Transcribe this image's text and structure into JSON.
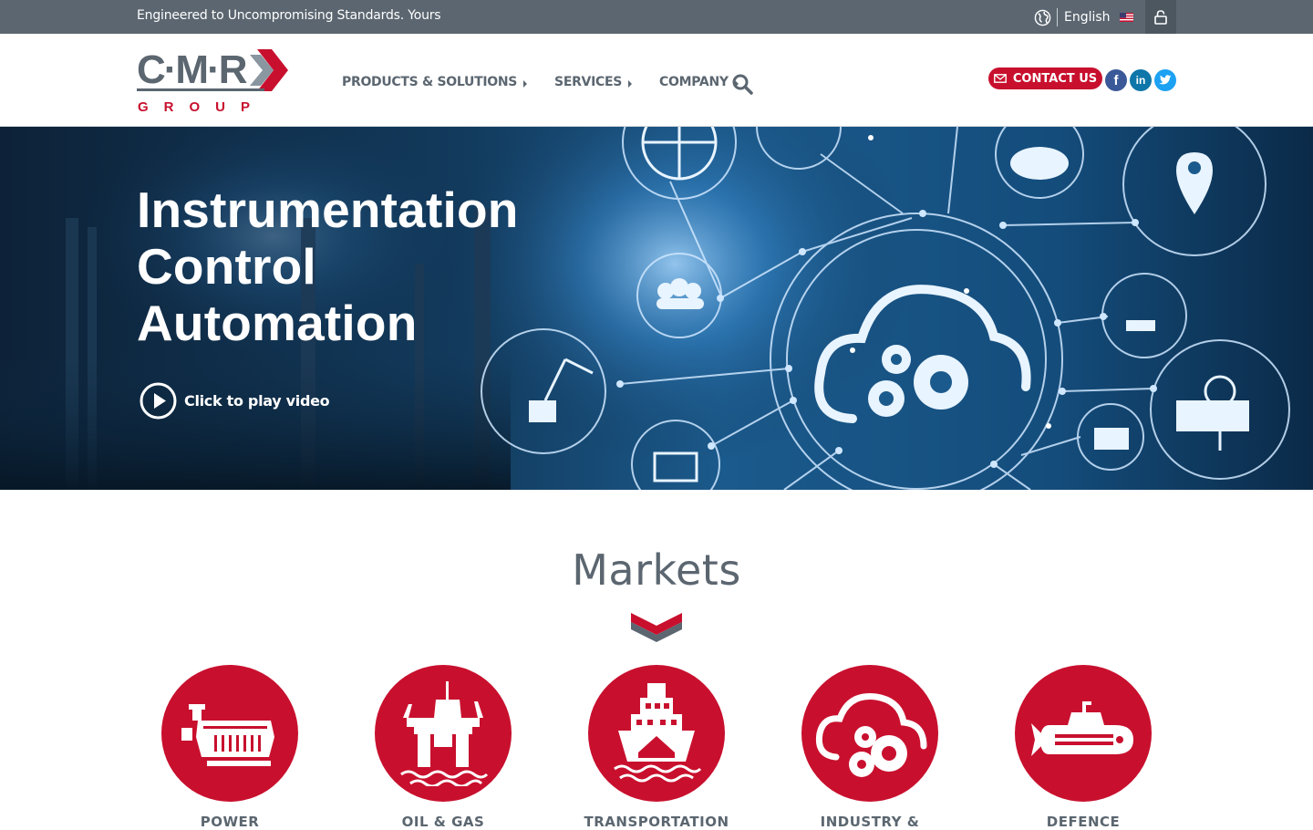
{
  "topbar": {
    "tagline": "Engineered to Uncompromising Standards. Yours",
    "language": "English"
  },
  "header": {
    "logo_text": "C·M·R",
    "logo_sub": "GROUP",
    "nav": [
      {
        "label": "PRODUCTS & SOLUTIONS"
      },
      {
        "label": "SERVICES"
      },
      {
        "label": "COMPANY"
      }
    ],
    "contact_label": "CONTACT US",
    "social": {
      "facebook": "f",
      "linkedin": "in",
      "twitter": "t"
    }
  },
  "hero": {
    "title_lines": [
      "Instrumentation",
      "Control",
      "Automation"
    ],
    "play_label": "Click to play video"
  },
  "markets": {
    "title": "Markets",
    "items": [
      {
        "label": "POWER",
        "icon": "engine-icon"
      },
      {
        "label": "OIL & GAS",
        "icon": "oil-rig-icon"
      },
      {
        "label": "TRANSPORTATION",
        "icon": "ship-icon"
      },
      {
        "label": "INDUSTRY &",
        "icon": "cloud-gears-icon"
      },
      {
        "label": "DEFENCE",
        "icon": "submarine-icon"
      }
    ]
  },
  "colors": {
    "brand_red": "#c8102e",
    "brand_grey": "#5b6670",
    "topbar": "#5b6670"
  }
}
